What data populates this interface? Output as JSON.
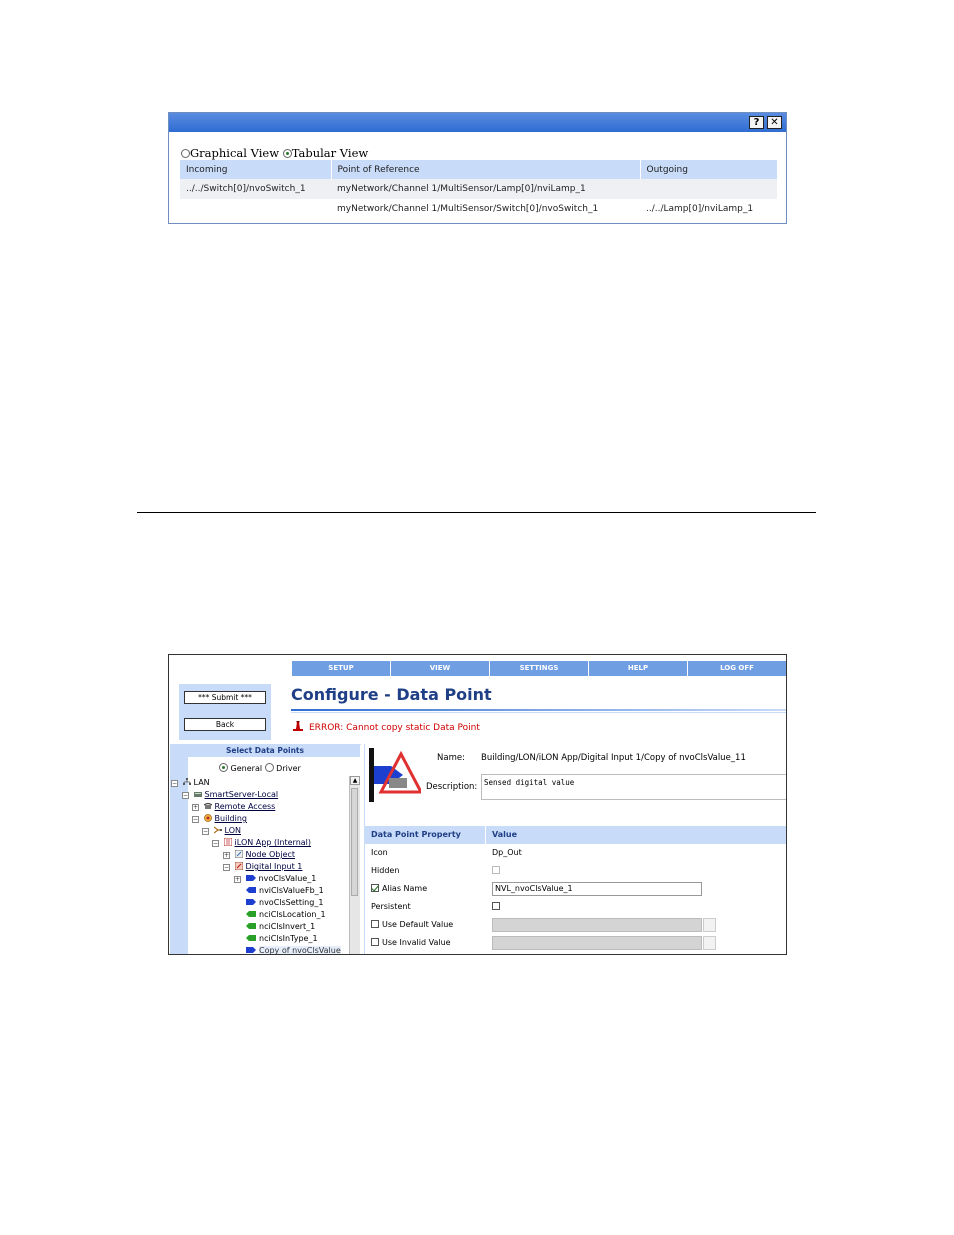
{
  "connections_dialog": {
    "help_label": "?",
    "close_label": "✕",
    "views": {
      "graphical_label": "Graphical View",
      "tabular_label": "Tabular View",
      "selected": "Tabular View"
    },
    "columns": [
      "Incoming",
      "Point of Reference",
      "Outgoing"
    ],
    "rows": [
      {
        "incoming": "../../Switch[0]/nvoSwitch_1",
        "reference": "myNetwork/Channel 1/MultiSensor/Lamp[0]/nviLamp_1",
        "outgoing": ""
      },
      {
        "incoming": "",
        "reference": "myNetwork/Channel 1/MultiSensor/Switch[0]/nvoSwitch_1",
        "outgoing": "../../Lamp[0]/nviLamp_1"
      }
    ]
  },
  "configure_window": {
    "menu": [
      "SETUP",
      "VIEW",
      "SETTINGS",
      "HELP",
      "LOG OFF"
    ],
    "submit_label": "*** Submit ***",
    "back_label": "Back",
    "page_title": "Configure - Data Point",
    "error_text": "ERROR: Cannot copy static Data Point",
    "tree": {
      "header": "Select Data Points",
      "general_label": "General",
      "driver_label": "Driver",
      "selected_option": "General",
      "nodes": {
        "lan": "LAN",
        "smartserver": "SmartServer-Local",
        "remote_access": "Remote Access",
        "building": "Building",
        "lon": "LON",
        "ilon_app": "iLON App (Internal)",
        "node_object": "Node Object",
        "digital_input": "Digital Input 1",
        "nvoClsValue": "nvoClsValue_1",
        "nviClsValueFb": "nviClsValueFb_1",
        "nvoClsSetting": "nvoClsSetting_1",
        "nciClsLocation": "nciClsLocation_1",
        "nciClsInvert": "nciClsInvert_1",
        "nciClsInType": "nciClsInType_1",
        "copy": "Copy of nvoClsValue"
      }
    },
    "form": {
      "name_label": "Name:",
      "name_value": "Building/LON/iLON App/Digital Input 1/Copy of nvoClsValue_11",
      "description_label": "Description:",
      "description_value": "Sensed digital value",
      "property_header": "Data Point Property",
      "value_header": "Value",
      "icon_label": "Icon",
      "icon_value": "Dp_Out",
      "hidden_label": "Hidden",
      "hidden_checked": false,
      "alias_label": "Alias Name",
      "alias_checked": true,
      "alias_value": "NVL_nvoClsValue_1",
      "persistent_label": "Persistent",
      "persistent_checked": false,
      "use_default_label": "Use Default Value",
      "use_default_checked": false,
      "use_invalid_label": "Use Invalid Value",
      "use_invalid_checked": false
    }
  },
  "colors": {
    "title_blue": "#1f3f86",
    "header_light_blue": "#c8dbf8",
    "menu_blue": "#6f9ee3",
    "error_red": "#d00000"
  }
}
